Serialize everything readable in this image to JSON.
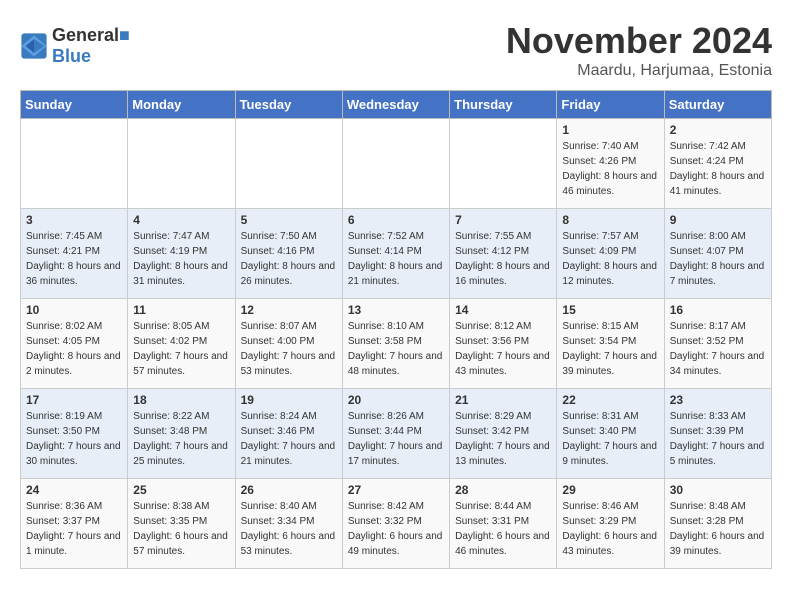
{
  "logo": {
    "line1": "General",
    "line2": "Blue"
  },
  "title": "November 2024",
  "subtitle": "Maardu, Harjumaa, Estonia",
  "days_of_week": [
    "Sunday",
    "Monday",
    "Tuesday",
    "Wednesday",
    "Thursday",
    "Friday",
    "Saturday"
  ],
  "weeks": [
    [
      {
        "day": "",
        "info": ""
      },
      {
        "day": "",
        "info": ""
      },
      {
        "day": "",
        "info": ""
      },
      {
        "day": "",
        "info": ""
      },
      {
        "day": "",
        "info": ""
      },
      {
        "day": "1",
        "info": "Sunrise: 7:40 AM\nSunset: 4:26 PM\nDaylight: 8 hours and 46 minutes."
      },
      {
        "day": "2",
        "info": "Sunrise: 7:42 AM\nSunset: 4:24 PM\nDaylight: 8 hours and 41 minutes."
      }
    ],
    [
      {
        "day": "3",
        "info": "Sunrise: 7:45 AM\nSunset: 4:21 PM\nDaylight: 8 hours and 36 minutes."
      },
      {
        "day": "4",
        "info": "Sunrise: 7:47 AM\nSunset: 4:19 PM\nDaylight: 8 hours and 31 minutes."
      },
      {
        "day": "5",
        "info": "Sunrise: 7:50 AM\nSunset: 4:16 PM\nDaylight: 8 hours and 26 minutes."
      },
      {
        "day": "6",
        "info": "Sunrise: 7:52 AM\nSunset: 4:14 PM\nDaylight: 8 hours and 21 minutes."
      },
      {
        "day": "7",
        "info": "Sunrise: 7:55 AM\nSunset: 4:12 PM\nDaylight: 8 hours and 16 minutes."
      },
      {
        "day": "8",
        "info": "Sunrise: 7:57 AM\nSunset: 4:09 PM\nDaylight: 8 hours and 12 minutes."
      },
      {
        "day": "9",
        "info": "Sunrise: 8:00 AM\nSunset: 4:07 PM\nDaylight: 8 hours and 7 minutes."
      }
    ],
    [
      {
        "day": "10",
        "info": "Sunrise: 8:02 AM\nSunset: 4:05 PM\nDaylight: 8 hours and 2 minutes."
      },
      {
        "day": "11",
        "info": "Sunrise: 8:05 AM\nSunset: 4:02 PM\nDaylight: 7 hours and 57 minutes."
      },
      {
        "day": "12",
        "info": "Sunrise: 8:07 AM\nSunset: 4:00 PM\nDaylight: 7 hours and 53 minutes."
      },
      {
        "day": "13",
        "info": "Sunrise: 8:10 AM\nSunset: 3:58 PM\nDaylight: 7 hours and 48 minutes."
      },
      {
        "day": "14",
        "info": "Sunrise: 8:12 AM\nSunset: 3:56 PM\nDaylight: 7 hours and 43 minutes."
      },
      {
        "day": "15",
        "info": "Sunrise: 8:15 AM\nSunset: 3:54 PM\nDaylight: 7 hours and 39 minutes."
      },
      {
        "day": "16",
        "info": "Sunrise: 8:17 AM\nSunset: 3:52 PM\nDaylight: 7 hours and 34 minutes."
      }
    ],
    [
      {
        "day": "17",
        "info": "Sunrise: 8:19 AM\nSunset: 3:50 PM\nDaylight: 7 hours and 30 minutes."
      },
      {
        "day": "18",
        "info": "Sunrise: 8:22 AM\nSunset: 3:48 PM\nDaylight: 7 hours and 25 minutes."
      },
      {
        "day": "19",
        "info": "Sunrise: 8:24 AM\nSunset: 3:46 PM\nDaylight: 7 hours and 21 minutes."
      },
      {
        "day": "20",
        "info": "Sunrise: 8:26 AM\nSunset: 3:44 PM\nDaylight: 7 hours and 17 minutes."
      },
      {
        "day": "21",
        "info": "Sunrise: 8:29 AM\nSunset: 3:42 PM\nDaylight: 7 hours and 13 minutes."
      },
      {
        "day": "22",
        "info": "Sunrise: 8:31 AM\nSunset: 3:40 PM\nDaylight: 7 hours and 9 minutes."
      },
      {
        "day": "23",
        "info": "Sunrise: 8:33 AM\nSunset: 3:39 PM\nDaylight: 7 hours and 5 minutes."
      }
    ],
    [
      {
        "day": "24",
        "info": "Sunrise: 8:36 AM\nSunset: 3:37 PM\nDaylight: 7 hours and 1 minute."
      },
      {
        "day": "25",
        "info": "Sunrise: 8:38 AM\nSunset: 3:35 PM\nDaylight: 6 hours and 57 minutes."
      },
      {
        "day": "26",
        "info": "Sunrise: 8:40 AM\nSunset: 3:34 PM\nDaylight: 6 hours and 53 minutes."
      },
      {
        "day": "27",
        "info": "Sunrise: 8:42 AM\nSunset: 3:32 PM\nDaylight: 6 hours and 49 minutes."
      },
      {
        "day": "28",
        "info": "Sunrise: 8:44 AM\nSunset: 3:31 PM\nDaylight: 6 hours and 46 minutes."
      },
      {
        "day": "29",
        "info": "Sunrise: 8:46 AM\nSunset: 3:29 PM\nDaylight: 6 hours and 43 minutes."
      },
      {
        "day": "30",
        "info": "Sunrise: 8:48 AM\nSunset: 3:28 PM\nDaylight: 6 hours and 39 minutes."
      }
    ]
  ]
}
